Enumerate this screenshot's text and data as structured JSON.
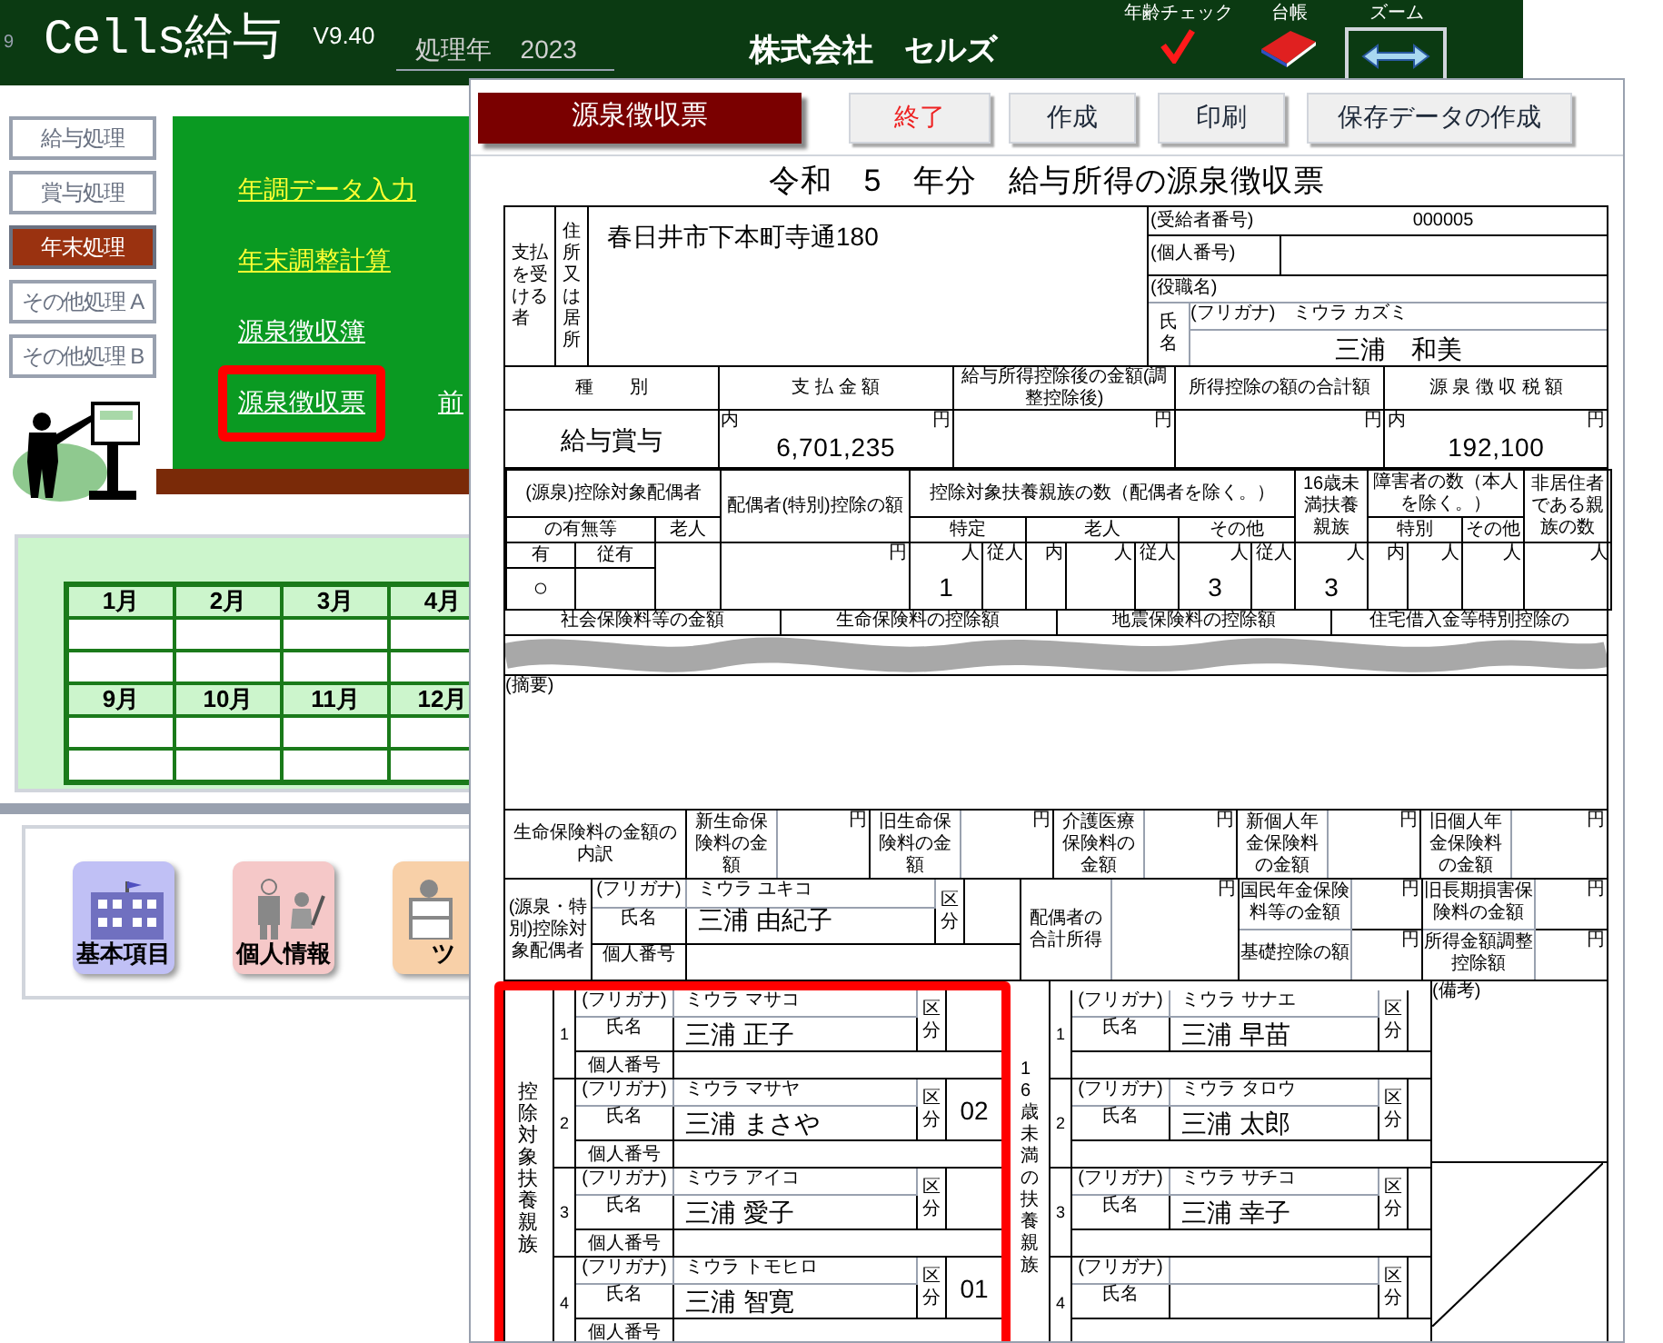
{
  "app": {
    "corner": "9",
    "title": "Cells給与",
    "version": "V9.40",
    "year_label": "処理年",
    "year": "2023",
    "company": "株式会社　セルズ",
    "tools": [
      {
        "kind": "check",
        "label": "年齢チェック"
      },
      {
        "kind": "ledger",
        "label": "台帳"
      },
      {
        "kind": "zoom",
        "label": "ズーム"
      }
    ],
    "menu": [
      {
        "label": "給与処理",
        "selected": false
      },
      {
        "label": "賞与処理",
        "selected": false
      },
      {
        "label": "年末処理",
        "selected": true
      },
      {
        "label": "その他処理 A",
        "selected": false
      },
      {
        "label": "その他処理 B",
        "selected": false
      }
    ],
    "link_rows": [
      [
        {
          "label": "年調データ入力",
          "color": "#ffff33",
          "highlighted": false
        }
      ],
      [
        {
          "label": "年末調整計算",
          "color": "#ffff33",
          "highlighted": false
        }
      ],
      [
        {
          "label": "源泉徴収簿",
          "color": "#ffffff",
          "highlighted": false
        }
      ],
      [
        {
          "label": "源泉徴収票",
          "color": "#ffffff",
          "highlighted": true
        },
        {
          "label": "前",
          "color": "#ffffff",
          "highlighted": false
        }
      ]
    ],
    "calendar_rows": [
      [
        "1月",
        "2月",
        "3月",
        "4月"
      ],
      [
        "9月",
        "10月",
        "11月",
        "12月"
      ]
    ],
    "shortcuts": [
      {
        "kind": "building",
        "label": "基本項目"
      },
      {
        "kind": "people",
        "label": "個人情報"
      },
      {
        "kind": "worker",
        "label": "ツ"
      }
    ]
  },
  "form": {
    "buttons": [
      {
        "kind": "title",
        "label": "源泉徴収票"
      },
      {
        "kind": "danger",
        "label": "終了"
      },
      {
        "kind": "normal",
        "label": "作成"
      },
      {
        "kind": "normal",
        "label": "印刷"
      },
      {
        "kind": "normal",
        "label": "保存データの作成"
      }
    ],
    "title": "令和　5　年分　給与所得の源泉徴収票",
    "payee": {
      "label": "支払を受ける者",
      "address_label": "住所又は居所",
      "address": "春日井市下本町寺通180",
      "recipient_no_label": "(受給者番号)",
      "recipient_no": "000005",
      "personal_no_label": "(個人番号)",
      "position_label": "(役職名)",
      "name_label": "氏名",
      "furigana_label": "(フリガナ)",
      "furigana": "ミウラ カズミ",
      "name": "三浦　和美"
    },
    "amounts": [
      {
        "header": "種　　別",
        "value": "給与賞与"
      },
      {
        "header": "支 払 金 額",
        "inner": "内",
        "unit": "円",
        "value": "6,701,235"
      },
      {
        "header": "給与所得控除後の金額(調整控除後)",
        "unit": "円"
      },
      {
        "header": "所得控除の額の合計額",
        "unit": "円"
      },
      {
        "header": "源 泉 徴 収 税 額",
        "inner": "内",
        "unit": "円",
        "value": "192,100"
      }
    ],
    "counts": {
      "spouse_label": "(源泉)控除対象配偶者",
      "spouse_sub": "の有無等",
      "spouse_elderly": "老人",
      "spouse_yes": "有",
      "spouse_yes_dep": "従有",
      "spouse_mark": "○",
      "deduction_label": "配偶者(特別)控除の額",
      "deduction_unit": "円",
      "dependents_label": "控除対象扶養親族の数（配偶者を除く。）",
      "groups": [
        {
          "label": "特定",
          "units": [
            {
              "unit": "人",
              "value": "1"
            },
            {
              "unit": "従人"
            }
          ]
        },
        {
          "label": "老人",
          "units": [
            {
              "unit": "内"
            },
            {
              "unit": "人"
            },
            {
              "unit": "従人"
            }
          ]
        },
        {
          "label": "その他",
          "units": [
            {
              "unit": "人",
              "value": "3"
            },
            {
              "unit": "従人"
            }
          ]
        }
      ],
      "under16_label": "16歳未満扶養親族",
      "under16_unit": "人",
      "under16_value": "3",
      "disabled_label": "障害者の数（本人を除く。）",
      "disabled_groups": [
        {
          "label": "特別",
          "units": [
            {
              "unit": "内"
            },
            {
              "unit": "人"
            }
          ]
        },
        {
          "label": "その他",
          "units": [
            {
              "unit": "人"
            }
          ]
        }
      ],
      "nonresident_label": "非居住者である親族の数",
      "nonresident_unit": "人"
    },
    "insurance_headers": [
      "社会保険料等の金額",
      "生命保険料の控除額",
      "地震保険料の控除額",
      "住宅借入金等特別控除の"
    ],
    "remarks_label": "(摘要)",
    "life_insurance": {
      "label": "生命保険料の金額の内訳",
      "items": [
        {
          "label": "新生命保険料の金額",
          "unit": "円"
        },
        {
          "label": "旧生命保険料の金額",
          "unit": "円"
        },
        {
          "label": "介護医療保険料の金額",
          "unit": "円"
        },
        {
          "label": "新個人年金保険料の金額",
          "unit": "円"
        },
        {
          "label": "旧個人年金保険料の金額",
          "unit": "円"
        }
      ]
    },
    "spouse": {
      "label": "(源泉・特別)控除対象配偶者",
      "furigana_label": "(フリガナ)",
      "furigana": "ミウラ ユキコ",
      "name_label": "氏名",
      "name": "三浦 由紀子",
      "category_label": "区分",
      "number_label": "個人番号",
      "income_label": "配偶者の合計所得",
      "income_unit": "円",
      "items": [
        {
          "label": "国民年金保険料等の金額",
          "unit": "円"
        },
        {
          "label": "旧長期損害保険料の金額",
          "unit": "円"
        },
        {
          "label": "基礎控除の額",
          "unit": "円"
        },
        {
          "label": "所得金額調整控除額",
          "unit": "円"
        }
      ]
    },
    "dependents": {
      "label": "控除対象扶養親族",
      "highlighted": true,
      "items": [
        {
          "index": "1",
          "furigana_label": "(フリガナ)",
          "furigana": "ミウラ マサコ",
          "name_label": "氏名",
          "name": "三浦 正子",
          "category_label": "区分",
          "number_label": "個人番号"
        },
        {
          "index": "2",
          "furigana_label": "(フリガナ)",
          "furigana": "ミウラ マサヤ",
          "name_label": "氏名",
          "name": "三浦 まさや",
          "category_label": "区分",
          "category": "02",
          "number_label": "個人番号"
        },
        {
          "index": "3",
          "furigana_label": "(フリガナ)",
          "furigana": "ミウラ アイコ",
          "name_label": "氏名",
          "name": "三浦 愛子",
          "category_label": "区分",
          "number_label": "個人番号"
        },
        {
          "index": "4",
          "furigana_label": "(フリガナ)",
          "furigana": "ミウラ トモヒロ",
          "name_label": "氏名",
          "name": "三浦 智寛",
          "category_label": "区分",
          "category": "01",
          "number_label": "個人番号"
        }
      ]
    },
    "under16": {
      "label": "16歳未満の扶養親族",
      "items": [
        {
          "index": "1",
          "furigana_label": "(フリガナ)",
          "furigana": "ミウラ サナエ",
          "name_label": "氏名",
          "name": "三浦 早苗",
          "category_label": "区分"
        },
        {
          "index": "2",
          "furigana_label": "(フリガナ)",
          "furigana": "ミウラ タロウ",
          "name_label": "氏名",
          "name": "三浦 太郎",
          "category_label": "区分"
        },
        {
          "index": "3",
          "furigana_label": "(フリガナ)",
          "furigana": "ミウラ サチコ",
          "name_label": "氏名",
          "name": "三浦 幸子",
          "category_label": "区分"
        },
        {
          "index": "4",
          "furigana_label": "(フリガナ)",
          "name_label": "氏名",
          "category_label": "区分"
        }
      ]
    },
    "notes_label": "(備考)"
  }
}
